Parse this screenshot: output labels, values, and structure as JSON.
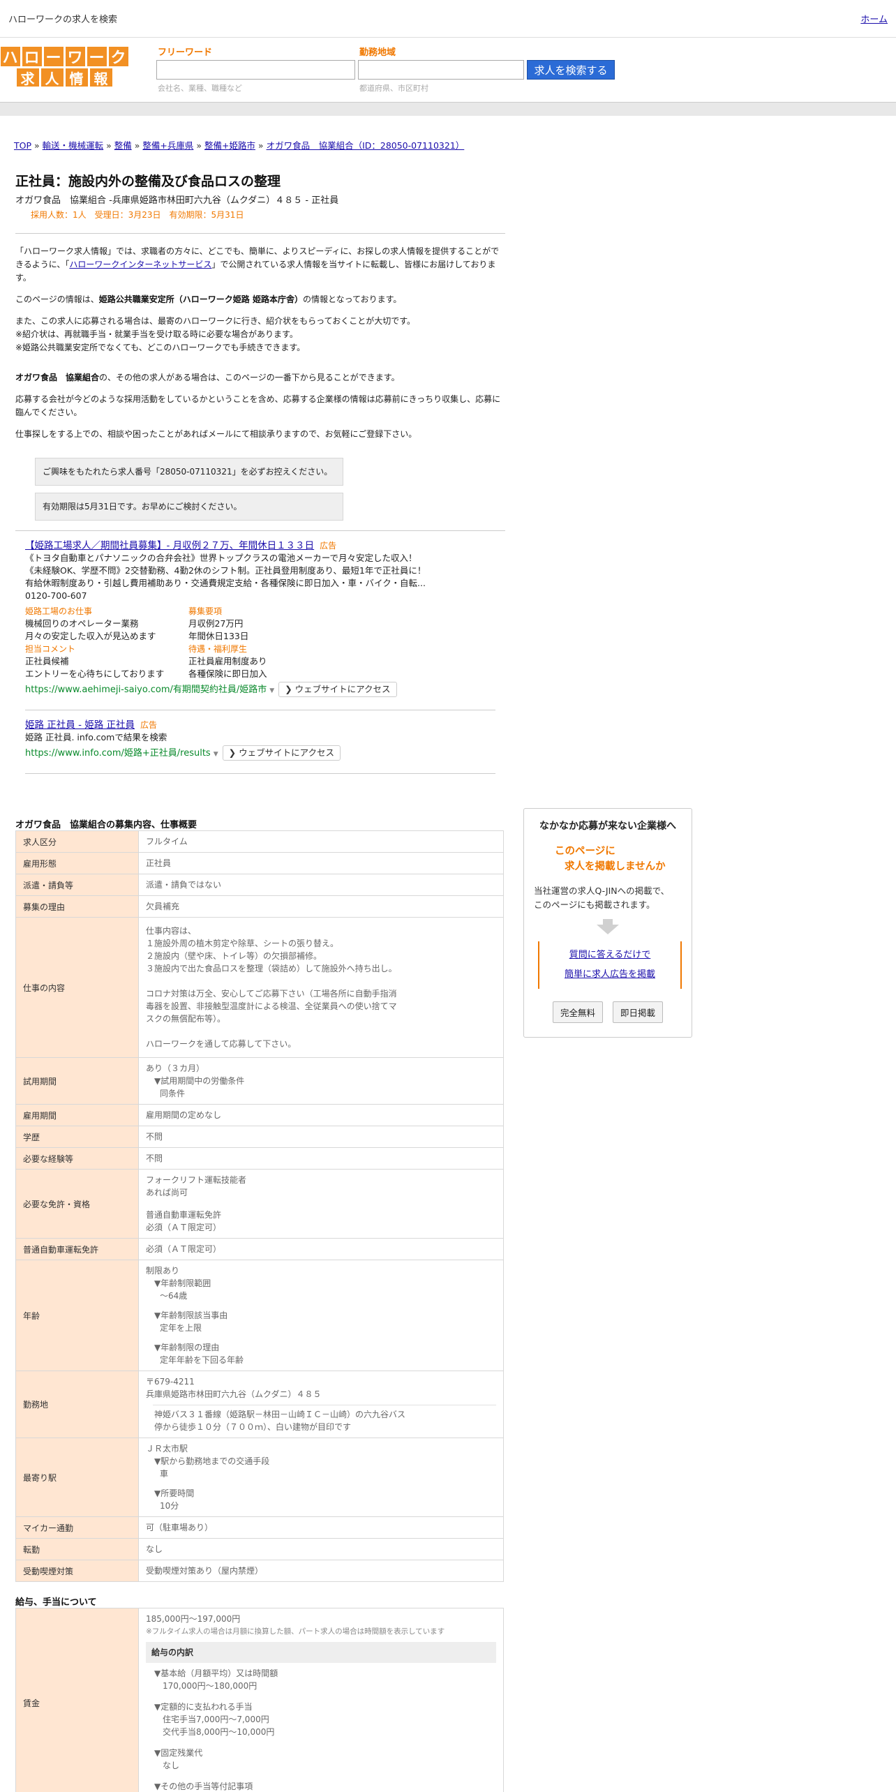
{
  "topbar": {
    "title": "ハローワークの求人を検索",
    "home": "ホーム"
  },
  "logo": {
    "row1": [
      "ハ",
      "ロ",
      "ー",
      "ワ",
      "ー",
      "ク"
    ],
    "row2": [
      "求",
      "人",
      "情",
      "報"
    ]
  },
  "search": {
    "freeword_label": "フリーワード",
    "freeword_hint": "会社名、業種、職種など",
    "area_label": "勤務地域",
    "area_hint": "都道府県、市区町村",
    "button": "求人を検索する"
  },
  "breadcrumb": {
    "items": [
      "TOP",
      "輸送・機械運転",
      "整備",
      "整備+兵庫県",
      "整備+姫路市",
      "オガワ食品　協業組合（ID：28050-07110321）"
    ],
    "sep": " » "
  },
  "job": {
    "title": "正社員：施設内外の整備及び食品ロスの整理",
    "subtitle": "オガワ食品　協業組合 -兵庫県姫路市林田町六九谷（ムクダニ）４８５ - 正社員",
    "meta": "採用人数：1人　受理日：3月23日　有効期限：5月31日"
  },
  "intro": {
    "p1a": "「ハローワーク求人情報」では、求職者の方々に、どこでも、簡単に、よりスピーディに、お探しの求人情報を提供することができるように、「",
    "p1link": "ハローワークインターネットサービス",
    "p1b": "」で公開されている求人情報を当サイトに転載し、皆様にお届けしております。",
    "p2a": "このページの情報は、",
    "p2b": "姫路公共職業安定所（ハローワーク姫路 姫路本庁舎）",
    "p2c": "の情報となっております。",
    "p3l1": "また、この求人に応募される場合は、最寄のハローワークに行き、紹介状をもらっておくことが大切です。",
    "p3l2": "※紹介状は、再就職手当・就業手当を受け取る時に必要な場合があります。",
    "p3l3": "※姫路公共職業安定所でなくても、どこのハローワークでも手続きできます。",
    "p4a": "オガワ食品　協業組合",
    "p4b": "の、その他の求人がある場合は、このページの一番下から見ることができます。",
    "p5": "応募する会社が今どのような採用活動をしているかということを含め、応募する企業様の情報は応募前にきっちり収集し、応募に臨んでください。",
    "p6": "仕事探しをする上での、相談や困ったことがあればメールにて相談承りますので、お気軽にご登録下さい。"
  },
  "notes": {
    "n1": "ご興味をもたれたら求人番号「28050-07110321」を必ずお控えください。",
    "n2": "有効期限は5月31日です。お早めにご検討ください。"
  },
  "ad1": {
    "title": "【姫路工場求人／期間社員募集】- 月収例２７万、年間休日１３３日",
    "tag": "広告",
    "l1": "《トヨタ自動車とパナソニックの合弁会社》世界トップクラスの電池メーカーで月々安定した収入！",
    "l2": "《未経験OK、学歴不問》2交替勤務、4勤2休のシフト制。正社員登用制度あり、最短1年で正社員に！",
    "l3": "有給休暇制度あり・引越し費用補助あり・交通費規定支給・各種保険に即日加入・車・バイク・自転...",
    "phone": "0120-700-607",
    "c1h": "姫路工場のお仕事",
    "c1l1": "機械回りのオペレーター業務",
    "c1l2": "月々の安定した収入が見込めます",
    "c2h": "募集要項",
    "c2l1": "月収例27万円",
    "c2l2": "年間休日133日",
    "c3h": "担当コメント",
    "c3l1": "正社員候補",
    "c3l2": "エントリーを心待ちにしております",
    "c4h": "待遇・福利厚生",
    "c4l1": "正社員雇用制度あり",
    "c4l2": "各種保険に即日加入",
    "url": "https://www.aehimeji-saiyo.com/有期間契約社員/姫路市",
    "visit": "ウェブサイトにアクセス"
  },
  "ad2": {
    "title": "姫路 正社員 - 姫路 正社員",
    "tag": "広告",
    "desc": "姫路 正社員. info.comで結果を検索",
    "url": "https://www.info.com/姫路+正社員/results",
    "visit": "ウェブサイトにアクセス"
  },
  "details": {
    "title": "オガワ食品　協業組合の募集内容、仕事概要",
    "rows": [
      {
        "h": "求人区分",
        "v": "フルタイム"
      },
      {
        "h": "雇用形態",
        "v": "正社員"
      },
      {
        "h": "派遣・請負等",
        "v": "派遣・請負ではない"
      },
      {
        "h": "募集の理由",
        "v": "欠員補充"
      }
    ],
    "work": {
      "h": "仕事の内容",
      "lines": [
        "仕事内容は、",
        "１施設外周の植木剪定や除草、シートの張り替え。",
        "２施設内（壁や床、トイレ等）の欠損部補修。",
        "３施設内で出た食品ロスを整理（袋詰め）して施設外へ持ち出し。",
        "",
        "コロナ対策は万全、安心してご応募下さい（工場各所に自動手指消",
        "毒器を設置、非接触型温度計による検温、全従業員への使い捨てマ",
        "スクの無償配布等）。",
        "",
        "ハローワークを通して応募して下さい。"
      ]
    },
    "trial": {
      "h": "試用期間",
      "l1": "あり（３カ月）",
      "l2": "▼試用期間中の労働条件",
      "l3": "同条件"
    },
    "rows2": [
      {
        "h": "雇用期間",
        "v": "雇用期間の定めなし"
      },
      {
        "h": "学歴",
        "v": "不問"
      },
      {
        "h": "必要な経験等",
        "v": "不問"
      }
    ],
    "license": {
      "h": "必要な免許・資格",
      "l1": "フォークリフト運転技能者",
      "l2": "あれば尚可",
      "l3": "普通自動車運転免許",
      "l4": "必須（ＡＴ限定可）"
    },
    "car": {
      "h": "普通自動車運転免許",
      "v": "必須（ＡＴ限定可）"
    },
    "age": {
      "h": "年齢",
      "l1": "制限あり",
      "l2": "▼年齢制限範囲",
      "l3": "〜64歳",
      "l4": "▼年齢制限該当事由",
      "l5": "定年を上限",
      "l6": "▼年齢制限の理由",
      "l7": "定年年齢を下回る年齢"
    },
    "place": {
      "h": "勤務地",
      "l1": "〒679-4211",
      "l2": "兵庫県姫路市林田町六九谷（ムクダニ）４８５",
      "l3": "神姫バス３１番線（姫路駅－林田－山崎ＩＣ－山崎）の六九谷バス",
      "l4": "停から徒歩１０分（７００ｍ）、白い建物が目印です"
    },
    "station": {
      "h": "最寄り駅",
      "l1": "ＪＲ太市駅",
      "l2": "▼駅から勤務地までの交通手段",
      "l3": "車",
      "l4": "▼所要時間",
      "l5": "10分"
    },
    "rows3": [
      {
        "h": "マイカー通勤",
        "v": "可（駐車場あり）"
      },
      {
        "h": "転勤",
        "v": "なし"
      },
      {
        "h": "受動喫煙対策",
        "v": "受動喫煙対策あり（屋内禁煙）"
      }
    ]
  },
  "salary": {
    "title": "給与、手当について",
    "h": "賃金",
    "range": "185,000円〜197,000円",
    "note": "※フルタイム求人の場合は月額に換算した額、パート求人の場合は時間額を表示しています",
    "breakdown": "給与の内訳",
    "b1": "▼基本給（月額平均）又は時間額",
    "b1v": "170,000円〜180,000円",
    "b2": "▼定額的に支払われる手当",
    "b2v1": "住宅手当7,000円〜7,000円",
    "b2v2": "交代手当8,000円〜10,000円",
    "b3": "▼固定残業代",
    "b3v": "なし",
    "b4": "▼その他の手当等付記事項"
  },
  "panel": {
    "title": "なかなか応募が来ない企業様へ",
    "orange1": "このページに",
    "orange2": "求人を掲載しませんか",
    "text1": "当社運営の求人Q-JINへの掲載で、",
    "text2": "このページにも掲載されます。",
    "link1": "質問に答えるだけで",
    "link2": "簡単に求人広告を掲載",
    "btn1": "完全無料",
    "btn2": "即日掲載"
  }
}
